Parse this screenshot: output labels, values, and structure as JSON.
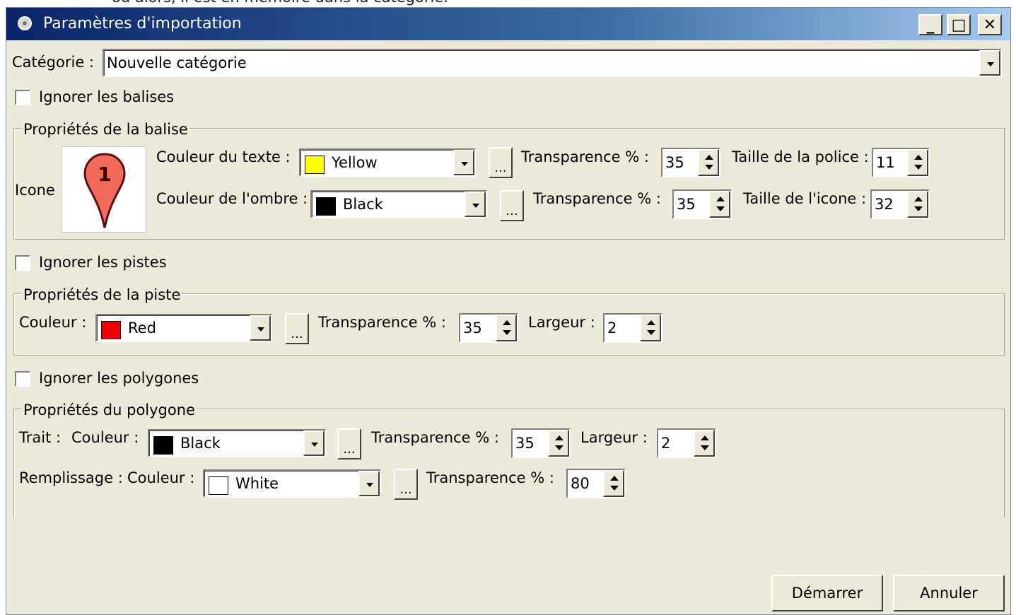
{
  "background_text": "où alors, il est en mémoire dans la catégorie.",
  "window": {
    "title": "Paramètres d'importation",
    "minimize": "_",
    "maximize": "□",
    "close": "✕"
  },
  "categorie": {
    "label": "Catégorie :",
    "value": "Nouvelle catégorie"
  },
  "ignore_balises": {
    "label": "Ignorer les balises",
    "checked": false
  },
  "balise": {
    "legend": "Propriétés de la balise",
    "icon_label": "Icone",
    "icon_number": "1",
    "text_color": {
      "label": "Couleur du texte :",
      "value": "Yellow",
      "swatch": "#ffff00"
    },
    "text_transparency": {
      "label": "Transparence % :",
      "value": "35"
    },
    "font_size": {
      "label": "Taille de la police :",
      "value": "11"
    },
    "shadow_color": {
      "label": "Couleur de l'ombre :",
      "value": "Black",
      "swatch": "#000000"
    },
    "shadow_transparency": {
      "label": "Transparence % :",
      "value": "35"
    },
    "icon_size": {
      "label": "Taille de l'icone :",
      "value": "32"
    }
  },
  "ignore_pistes": {
    "label": "Ignorer les pistes",
    "checked": false
  },
  "piste": {
    "legend": "Propriétés de la piste",
    "color": {
      "label": "Couleur :",
      "value": "Red",
      "swatch": "#ee0000"
    },
    "transparency": {
      "label": "Transparence % :",
      "value": "35"
    },
    "width": {
      "label": "Largeur :",
      "value": "2"
    }
  },
  "ignore_polygones": {
    "label": "Ignorer les polygones",
    "checked": false
  },
  "polygone": {
    "legend": "Propriétés du polygone",
    "trait": {
      "label": "Trait :",
      "color_label": "Couleur :",
      "color": "Black",
      "swatch": "#000000",
      "transparency_label": "Transparence % :",
      "transparency": "35",
      "width_label": "Largeur :",
      "width": "2"
    },
    "fill": {
      "label": "Remplissage :",
      "color_label": "Couleur :",
      "color": "White",
      "swatch": "#ffffff",
      "transparency_label": "Transparence % :",
      "transparency": "80"
    }
  },
  "dots_label": "...",
  "buttons": {
    "start": "Démarrer",
    "cancel": "Annuler"
  }
}
